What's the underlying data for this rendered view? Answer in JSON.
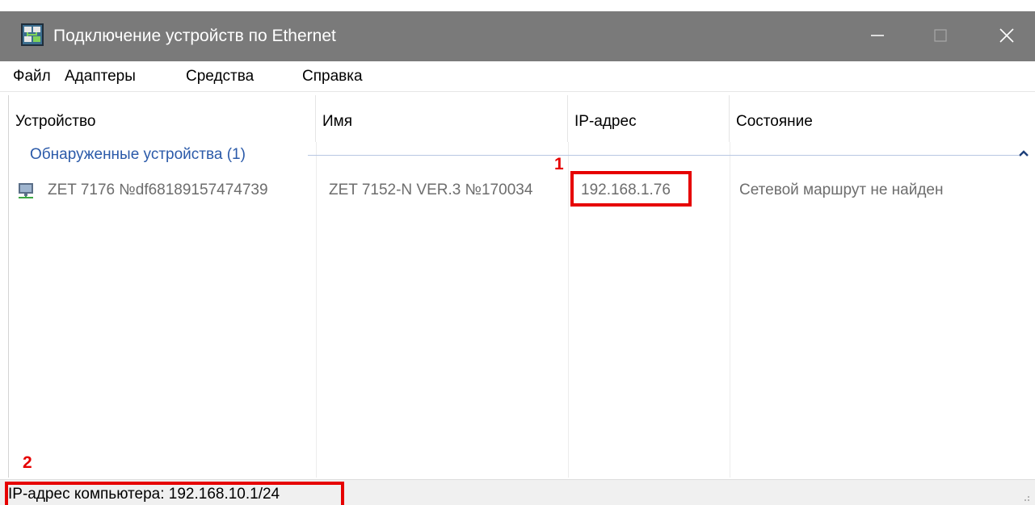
{
  "window": {
    "title": "Подключение устройств по Ethernet",
    "icon": "network-app-icon",
    "controls": [
      "minimize-icon",
      "maximize-icon",
      "close-icon"
    ]
  },
  "menu": {
    "items": [
      {
        "label": "Файл"
      },
      {
        "label": "Адаптеры"
      },
      {
        "label": "Средства"
      },
      {
        "label": "Справка"
      }
    ]
  },
  "table": {
    "columns": [
      {
        "label": "Устройство"
      },
      {
        "label": "Имя"
      },
      {
        "label": "IP-адрес"
      },
      {
        "label": "Состояние"
      }
    ],
    "group": {
      "label": "Обнаруженные устройства (1)",
      "icon": "chevron-up-icon"
    },
    "rows": [
      {
        "icon": "computer-network-icon",
        "device": "ZET 7176 №df68189157474739",
        "name": "ZET 7152-N VER.3 №170034",
        "ip": "192.168.1.76",
        "status": "Сетевой маршрут не найден"
      }
    ]
  },
  "annotations": {
    "marker1": "1",
    "marker2": "2",
    "color": "#e60000"
  },
  "statusbar": {
    "text": "IP-адрес компьютера: 192.168.10.1/24"
  },
  "colors": {
    "titlebar": "#7a7a7a",
    "group_text": "#2b5aa9",
    "row_text": "#6d6d6d"
  }
}
